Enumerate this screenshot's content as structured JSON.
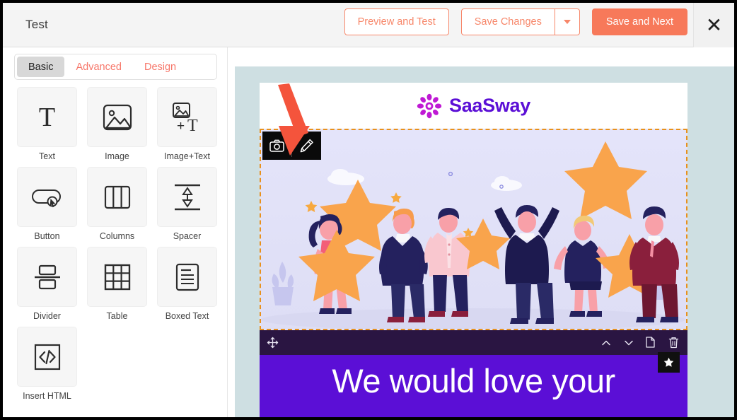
{
  "header": {
    "title": "Test",
    "preview_label": "Preview and Test",
    "save_changes_label": "Save Changes",
    "save_next_label": "Save and Next",
    "close_label": "✕",
    "accent_outline": "#f7876a",
    "accent_solid": "#f7795a"
  },
  "sidebar": {
    "tabs": [
      {
        "label": "Basic",
        "active": true
      },
      {
        "label": "Advanced",
        "active": false
      },
      {
        "label": "Design",
        "active": false
      }
    ],
    "blocks": [
      {
        "label": "Text",
        "icon": "text-serif-T-icon"
      },
      {
        "label": "Image",
        "icon": "image-picture-icon"
      },
      {
        "label": "Image+Text",
        "icon": "image-plus-text-icon"
      },
      {
        "label": "Button",
        "icon": "button-cursor-icon"
      },
      {
        "label": "Columns",
        "icon": "columns-three-icon"
      },
      {
        "label": "Spacer",
        "icon": "spacer-arrows-icon"
      },
      {
        "label": "Divider",
        "icon": "divider-split-icon"
      },
      {
        "label": "Table",
        "icon": "table-grid-icon"
      },
      {
        "label": "Boxed Text",
        "icon": "boxed-text-document-icon"
      },
      {
        "label": "Insert HTML",
        "icon": "code-brackets-icon"
      }
    ]
  },
  "canvas": {
    "background_color": "#cedfe2",
    "email": {
      "brand_name": "SaaSway",
      "brand_color": "#5b0fd6",
      "logo_icon": "flower-petal-logo-icon",
      "selected_block": {
        "selection_color": "#e8911d",
        "image_alt": "people-holding-stars-illustration",
        "image_toolbar": [
          {
            "icon": "camera-icon",
            "name": "replace-image"
          },
          {
            "icon": "pencil-icon",
            "name": "edit-image"
          }
        ],
        "block_toolbar": {
          "move": {
            "icon": "move-arrows-icon"
          },
          "actions": [
            {
              "icon": "chevron-up-icon",
              "name": "move-up"
            },
            {
              "icon": "chevron-down-icon",
              "name": "move-down"
            },
            {
              "icon": "duplicate-icon",
              "name": "duplicate-block"
            },
            {
              "icon": "trash-icon",
              "name": "delete-block"
            }
          ]
        },
        "star_badge": {
          "icon": "star-icon"
        }
      },
      "banner": {
        "text": "We would love your",
        "background": "#5b0fd6",
        "text_color": "#ffffff"
      }
    }
  },
  "annotation": {
    "arrow_color": "#f4543c",
    "points_to": "edit-image-pencil-button"
  }
}
